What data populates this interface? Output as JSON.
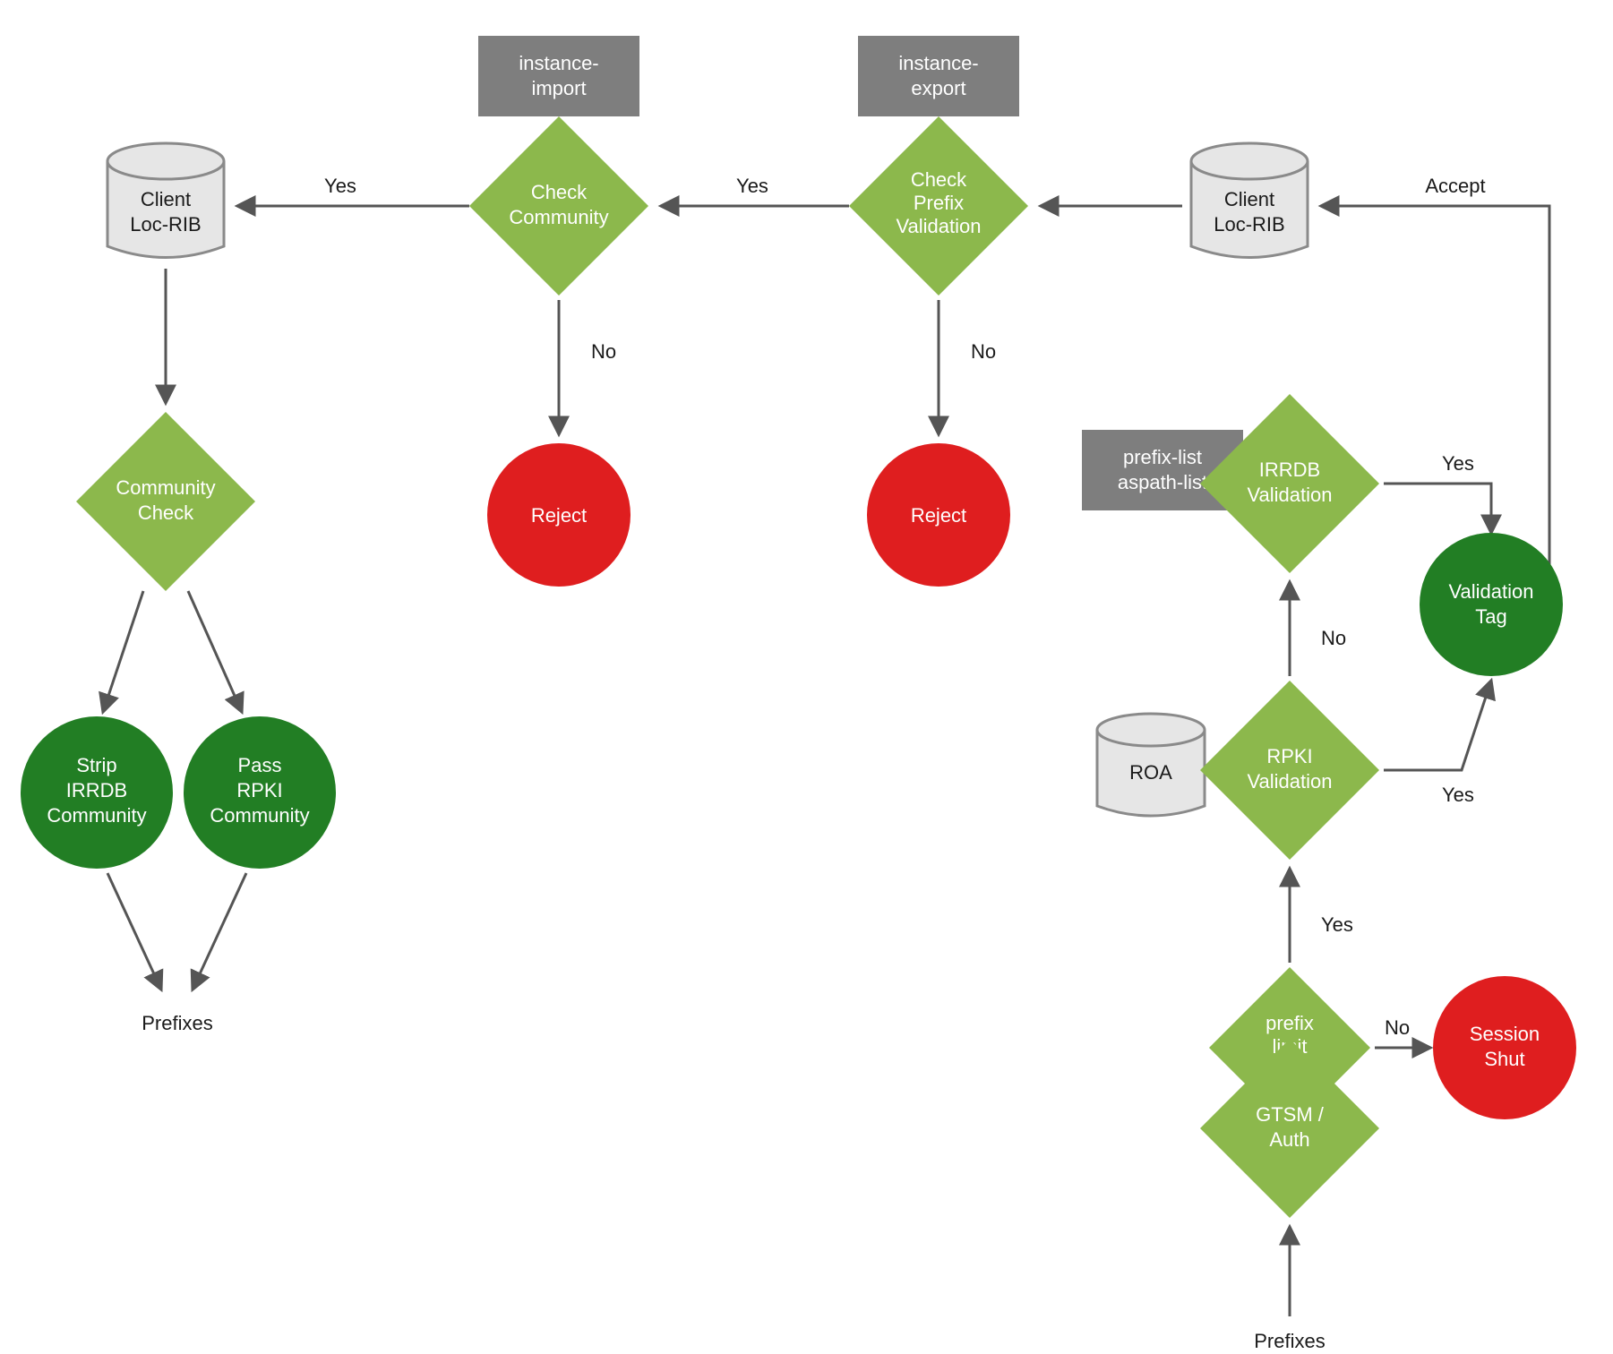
{
  "colors": {
    "diamond": "#8cb84c",
    "greyBox": "#7e7e7e",
    "circleGreen": "#227e24",
    "circleRed": "#df1e1f",
    "dbFill": "#e6e6e6",
    "dbStroke": "#8a8a8a",
    "edge": "#555555"
  },
  "labels": {
    "yes": "Yes",
    "no": "No",
    "accept": "Accept",
    "prefixes": "Prefixes"
  },
  "boxes": {
    "instanceImport": {
      "l1": "instance-",
      "l2": "import"
    },
    "instanceExport": {
      "l1": "instance-",
      "l2": "export"
    },
    "prefixAspath": {
      "l1": "prefix-list",
      "l2": "aspath-list"
    }
  },
  "db": {
    "clientLocRibLeft": {
      "l1": "Client",
      "l2": "Loc-RIB"
    },
    "clientLocRibRight": {
      "l1": "Client",
      "l2": "Loc-RIB"
    },
    "roa": "ROA"
  },
  "diamonds": {
    "checkCommunity": {
      "l1": "Check",
      "l2": "Community"
    },
    "checkPrefixValidation": {
      "l1": "Check",
      "l2": "Prefix",
      "l3": "Validation"
    },
    "communityCheck": {
      "l1": "Community",
      "l2": "Check"
    },
    "irrdbValidation": {
      "l1": "IRRDB",
      "l2": "Validation"
    },
    "rpkiValidation": {
      "l1": "RPKI",
      "l2": "Validation"
    },
    "prefixLimit": {
      "l1": "prefix",
      "l2": "limit"
    },
    "gtsmAuth": {
      "l1": "GTSM /",
      "l2": "Auth"
    }
  },
  "circles": {
    "reject1": "Reject",
    "reject2": "Reject",
    "stripIrrdb": {
      "l1": "Strip",
      "l2": "IRRDB",
      "l3": "Community"
    },
    "passRpki": {
      "l1": "Pass",
      "l2": "RPKI",
      "l3": "Community"
    },
    "validationTag": {
      "l1": "Validation",
      "l2": "Tag"
    },
    "sessionShut": {
      "l1": "Session",
      "l2": "Shut"
    }
  }
}
